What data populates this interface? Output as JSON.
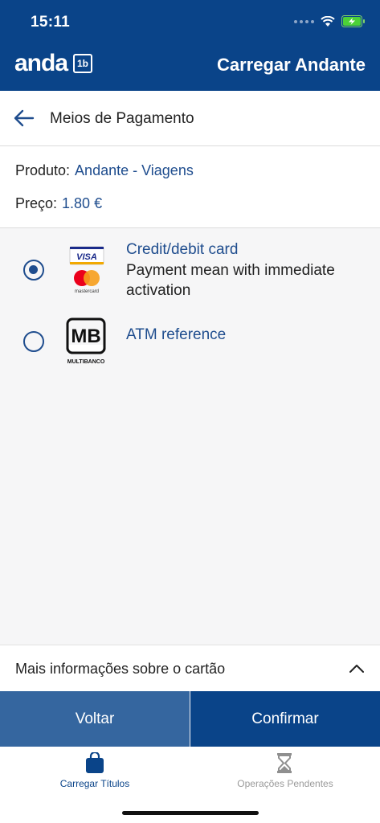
{
  "status_bar": {
    "time": "15:11"
  },
  "header": {
    "logo_text": "anda",
    "logo_badge": "1b",
    "title": "Carregar Andante"
  },
  "nav": {
    "title": "Meios de Pagamento"
  },
  "product": {
    "product_label": "Produto:",
    "product_value": "Andante - Viagens",
    "price_label": "Preço:",
    "price_value": "1.80 €"
  },
  "payment_options": [
    {
      "title": "Credit/debit card",
      "description": "Payment mean with immediate activation",
      "selected": true,
      "logo_top": "VISA",
      "logo_bottom": "mastercard"
    },
    {
      "title": "ATM reference",
      "selected": false,
      "logo_top": "MB",
      "logo_bottom": "MULTIBANCO"
    }
  ],
  "more_info": {
    "label": "Mais informações sobre o cartão"
  },
  "buttons": {
    "back": "Voltar",
    "confirm": "Confirmar"
  },
  "tabs": [
    {
      "label": "Carregar Títulos",
      "active": true,
      "icon": "bag-icon"
    },
    {
      "label": "Operações Pendentes",
      "active": false,
      "icon": "hourglass-icon"
    }
  ],
  "colors": {
    "primary": "#0a4489",
    "secondary_button": "#35669f",
    "accent_text": "#1f4d8e",
    "inactive_tab": "#9a9a9a"
  }
}
